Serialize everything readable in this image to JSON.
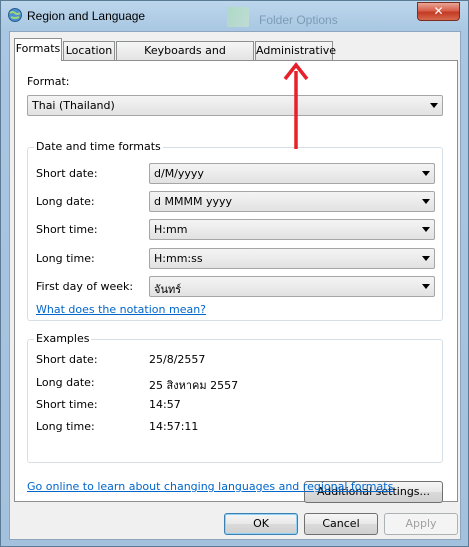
{
  "window": {
    "title": "Region and Language",
    "background_title": "Folder Options",
    "close_glyph": "✕"
  },
  "tabs": [
    {
      "label": "Formats",
      "active": true
    },
    {
      "label": "Location",
      "active": false
    },
    {
      "label": "Keyboards and Languages",
      "active": false
    },
    {
      "label": "Administrative",
      "active": false
    }
  ],
  "format": {
    "label": "Format:",
    "value": "Thai (Thailand)"
  },
  "date_time": {
    "title": "Date and time formats",
    "rows": [
      {
        "label": "Short date:",
        "value": "d/M/yyyy"
      },
      {
        "label": "Long date:",
        "value": "d MMMM yyyy"
      },
      {
        "label": "Short time:",
        "value": "H:mm"
      },
      {
        "label": "Long time:",
        "value": "H:mm:ss"
      },
      {
        "label": "First day of week:",
        "value": "จันทร์"
      }
    ],
    "notation_link": "What does the notation mean?"
  },
  "examples": {
    "title": "Examples",
    "rows": [
      {
        "label": "Short date:",
        "value": "25/8/2557"
      },
      {
        "label": "Long date:",
        "value": "25 สิงหาคม 2557"
      },
      {
        "label": "Short time:",
        "value": "14:57"
      },
      {
        "label": "Long time:",
        "value": "14:57:11"
      }
    ]
  },
  "additional_settings": "Additional settings...",
  "online_link": "Go online to learn about changing languages and regional formats",
  "buttons": {
    "ok": "OK",
    "cancel": "Cancel",
    "apply": "Apply"
  },
  "colors": {
    "link": "#0066cc",
    "annotation_arrow": "#e8202a"
  }
}
